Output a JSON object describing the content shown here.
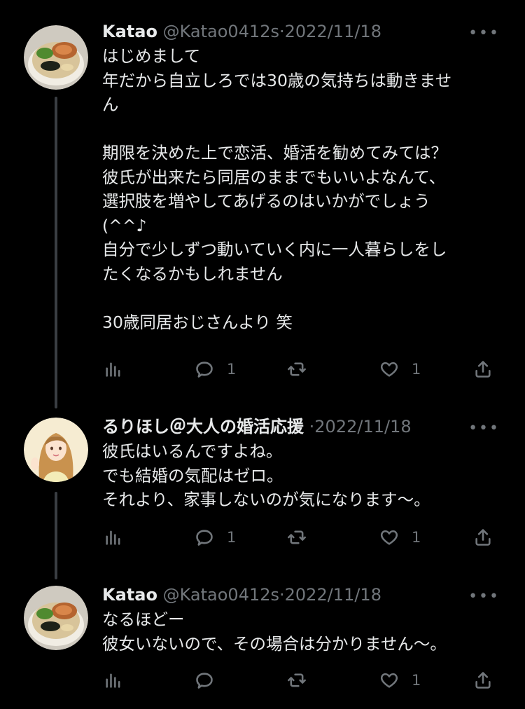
{
  "tweets": [
    {
      "name": "Katao",
      "handle": "@Katao0412s",
      "sep": "·",
      "date": "2022/11/18",
      "more": "•••",
      "lines": [
        "はじめまして",
        "年だから自立しろでは30歳の気持ちは動きませ",
        "ん",
        "",
        "期限を決めた上で恋活、婚活を勧めてみては？",
        "彼氏が出来たら同居のままでもいいよなんて、",
        "選択肢を増やしてあげるのはいかがでしょう",
        "(^^♪",
        "自分で少しずつ動いていく内に一人暮らしをし",
        "たくなるかもしれません",
        "",
        "30歳同居おじさんより 笑"
      ],
      "replies": "1",
      "retweets": "",
      "likes": "1"
    },
    {
      "name": "るりほし＠大人の婚活応援",
      "handle": "",
      "sep": "·",
      "date": "2022/11/18",
      "more": "•••",
      "lines": [
        "彼氏はいるんですよね。",
        "でも結婚の気配はゼロ。",
        "それより、家事しないのが気になります〜。"
      ],
      "replies": "1",
      "retweets": "",
      "likes": "1"
    },
    {
      "name": "Katao",
      "handle": "@Katao0412s",
      "sep": "·",
      "date": "2022/11/18",
      "more": "•••",
      "lines": [
        "なるほどー",
        "彼女いないので、その場合は分かりません〜。"
      ],
      "replies": "",
      "retweets": "",
      "likes": "1"
    }
  ],
  "colors": {
    "text": "#e7e9ea",
    "muted": "#71767b",
    "background": "#000000",
    "thread_line": "#3a3e43"
  },
  "icons": [
    "analytics-icon",
    "reply-icon",
    "retweet-icon",
    "like-icon",
    "share-icon",
    "more-icon"
  ]
}
